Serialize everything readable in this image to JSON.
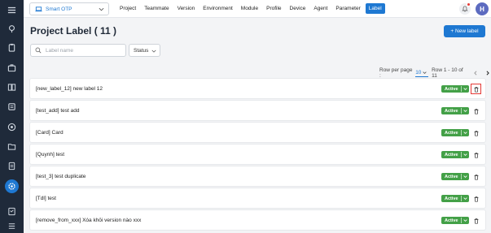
{
  "colors": {
    "accent": "#1e78d2",
    "sidebar": "#1f2a3a",
    "status_active": "#43a047",
    "highlight": "#e53935"
  },
  "topbar": {
    "project_name": "Smart OTP",
    "nav": [
      "Project",
      "Teammate",
      "Version",
      "Environment",
      "Module",
      "Profile",
      "Device",
      "Agent",
      "Parameter",
      "Label"
    ],
    "active_nav": "Label",
    "avatar_initial": "H"
  },
  "page": {
    "title": "Project Label ( 11 )",
    "new_label_button": "+ New label"
  },
  "filters": {
    "search_placeholder": "Label name",
    "status_label": "Status"
  },
  "pager": {
    "rows_per_page_label": "Row per page :",
    "rows_per_page_value": "10",
    "range_text": "Row 1 - 10 of 11"
  },
  "labels": [
    {
      "text": "[new_label_12] new label 12",
      "status": "Active"
    },
    {
      "text": "[test_add] test add",
      "status": "Active"
    },
    {
      "text": "[Card] Card",
      "status": "Active"
    },
    {
      "text": "[Quynh] test",
      "status": "Active"
    },
    {
      "text": "[test_3] test duplicate",
      "status": "Active"
    },
    {
      "text": "[Tdl] test",
      "status": "Active"
    },
    {
      "text": "[remove_from_xxx] Xóa khỏi version nào xxx",
      "status": "Active"
    }
  ],
  "icons": {
    "sidebar": [
      "pin-icon",
      "clipboard-icon",
      "book-icon",
      "briefcase-icon",
      "gear-circle-icon",
      "folder-icon",
      "file-icon",
      "settings-icon",
      "tasks-icon",
      "list-icon"
    ],
    "project_select": "laptop-icon",
    "search": "search-icon",
    "notification": "bell-icon",
    "delete": "trash-icon"
  }
}
